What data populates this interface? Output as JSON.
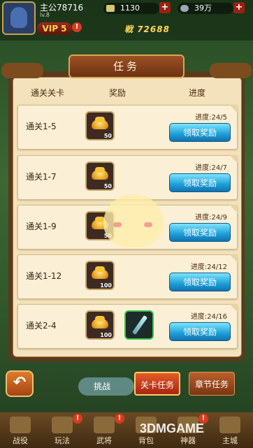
{
  "player": {
    "name": "主公78716",
    "level": "lv.8",
    "vip": "VIP 5",
    "power": "72688"
  },
  "resources": [
    {
      "icon": "gold-ingot-icon",
      "value": "1130"
    },
    {
      "icon": "silver-coin-icon",
      "value": "39万"
    }
  ],
  "dialog": {
    "title": "任务",
    "headers": {
      "stage": "通关关卡",
      "reward": "奖励",
      "progress": "进度"
    },
    "claim_label": "领取奖励",
    "rows": [
      {
        "stage": "通关1-5",
        "gold_qty": "50",
        "progress": "进度:24/5",
        "has_sword": false
      },
      {
        "stage": "通关1-7",
        "gold_qty": "50",
        "progress": "进度:24/7",
        "has_sword": false
      },
      {
        "stage": "通关1-9",
        "gold_qty": "50",
        "progress": "进度:24/9",
        "has_sword": false
      },
      {
        "stage": "通关1-12",
        "gold_qty": "100",
        "progress": "进度:24/12",
        "has_sword": false
      },
      {
        "stage": "通关2-4",
        "gold_qty": "100",
        "progress": "进度:24/16",
        "has_sword": true
      }
    ]
  },
  "bottom": {
    "challenge": "挑战",
    "tab_stage": "关卡任务",
    "tab_chapter": "章节任务"
  },
  "nav": [
    {
      "label": "战役",
      "icon": "battle-icon"
    },
    {
      "label": "玩法",
      "icon": "gameplay-icon"
    },
    {
      "label": "武将",
      "icon": "general-icon"
    },
    {
      "label": "背包",
      "icon": "bag-icon"
    },
    {
      "label": "神器",
      "icon": "artifact-icon"
    },
    {
      "label": "主城",
      "icon": "city-icon"
    }
  ],
  "watermark": "3DMGAME",
  "colors": {
    "claim_button": "#1b9ed6",
    "panel": "#f3e2bc",
    "active_tab": "#e45a28"
  }
}
